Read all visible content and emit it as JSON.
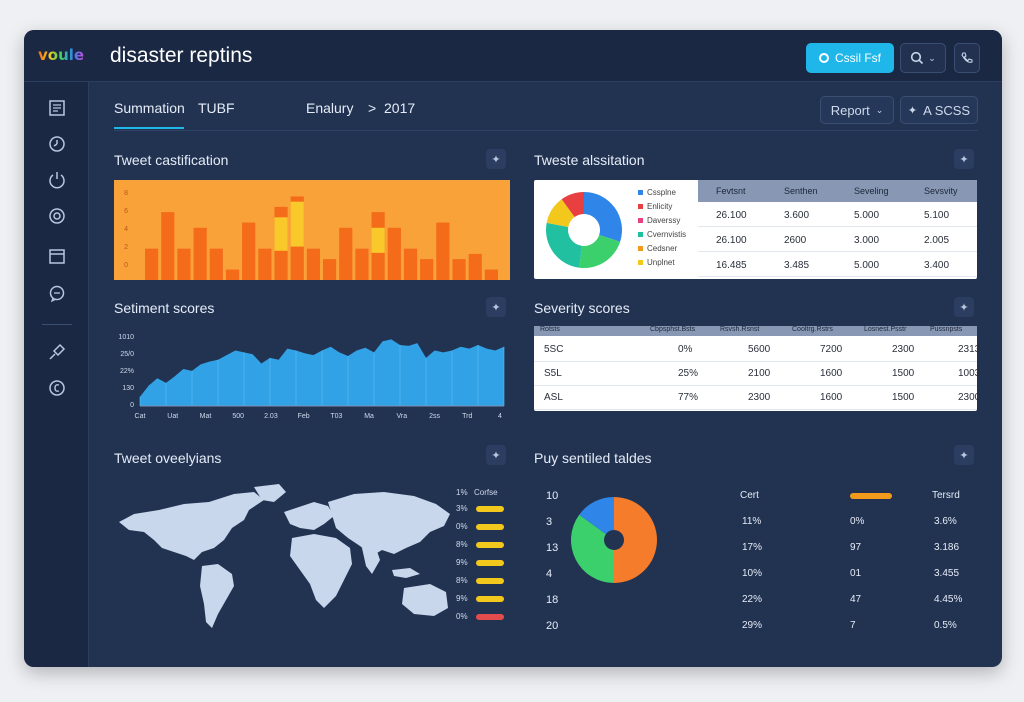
{
  "app": {
    "logo": "voule",
    "title": "disaster reptins"
  },
  "header": {
    "primary_button": "Cssil Fsf",
    "search_icon": "search-icon",
    "phone_icon": "phone-icon"
  },
  "tabs": {
    "active": "Summation",
    "tag": "TUBF",
    "crumb_left": "Enalury",
    "crumb_sep": ">",
    "crumb_right": "2017"
  },
  "toolbar": {
    "report": "Report",
    "access": "A SCSS"
  },
  "panels": {
    "tweet_class": {
      "title": "Tweet castification"
    },
    "tweet_assoc": {
      "title": "Tweste alssitation",
      "legend": [
        {
          "label": "Cssplne",
          "color": "#2f86e8"
        },
        {
          "label": "Enlicity",
          "color": "#e84040"
        },
        {
          "label": "Daverssy",
          "color": "#e84080"
        },
        {
          "label": "Cvernvistis",
          "color": "#21c0a0"
        },
        {
          "label": "Cedsner",
          "color": "#f29a1c"
        },
        {
          "label": "Unplnet",
          "color": "#f2c81c"
        }
      ],
      "headers": [
        "Fevtsnt",
        "Senthen",
        "Seveling",
        "Sevsvity"
      ],
      "rows": [
        [
          "26.100",
          "3.600",
          "5.000",
          "5.100"
        ],
        [
          "26.100",
          "2600",
          "3.000",
          "2.005"
        ],
        [
          "16.485",
          "3.485",
          "5.000",
          "3.400"
        ]
      ]
    },
    "sentiment": {
      "title": "Setiment scores",
      "yticks": [
        "1010",
        "25/0",
        "22%",
        "130",
        "0"
      ],
      "xticks": [
        "Cat",
        "Uat",
        "Mat",
        "500",
        "2.03",
        "Feb",
        "T03",
        "Ma",
        "Vra",
        "2ss",
        "Trd",
        "4"
      ]
    },
    "severity": {
      "title": "Severity scores",
      "headers": [
        "Rotsts",
        "Cbpsphst.Bsts",
        "Rsvsh.Rsnst",
        "Cooltrg.Rstrs",
        "Losnest.Psstr",
        "Pussnpsts"
      ],
      "rows": [
        [
          "5SC",
          "0%",
          "5600",
          "7200",
          "2300",
          "2313"
        ],
        [
          "S5L",
          "25%",
          "2100",
          "1600",
          "1500",
          "1003"
        ],
        [
          "ASL",
          "77%",
          "2300",
          "1600",
          "1500",
          "2300"
        ]
      ]
    },
    "tweet_overlay": {
      "title": "Tweet oveelyians",
      "legend_header": [
        "1%",
        "Corfse"
      ],
      "legend": [
        {
          "label": "3%",
          "color": "#f2c81c"
        },
        {
          "label": "0%",
          "color": "#f2c81c"
        },
        {
          "label": "8%",
          "color": "#f2c81c"
        },
        {
          "label": "9%",
          "color": "#f2c81c"
        },
        {
          "label": "8%",
          "color": "#f2c81c"
        },
        {
          "label": "9%",
          "color": "#f2c81c"
        },
        {
          "label": "0%",
          "color": "#e34c4c"
        }
      ]
    },
    "pie_table": {
      "title": "Puy sentiled taldes",
      "col_left": [
        "10",
        "3",
        "13",
        "4",
        "18",
        "20"
      ],
      "col_a_header": "Cert",
      "col_a": [
        "",
        "11%",
        "17%",
        "10%",
        "22%",
        "29%"
      ],
      "col_b": [
        "",
        "0%",
        "97",
        "01",
        "47",
        "7"
      ],
      "col_c_header": "Tersrd",
      "col_c": [
        "",
        "3.6%",
        "3.186",
        "3.455",
        "4.45%",
        "0.5%"
      ]
    }
  },
  "chart_data": [
    {
      "type": "bar",
      "title": "Tweet castification",
      "yticks": [
        "8",
        "6",
        "4",
        "2",
        "0"
      ],
      "values": [
        3,
        6.5,
        3,
        5,
        3,
        1,
        5.5,
        3,
        7,
        8,
        3,
        2,
        5,
        3,
        6.5,
        5,
        3,
        2,
        5.5,
        2,
        2.5,
        1
      ],
      "highlights": [
        0,
        0,
        0,
        0,
        0,
        0,
        0,
        0,
        6,
        7.5,
        0,
        0,
        0,
        0,
        5,
        0,
        0,
        0,
        0,
        0,
        0,
        0
      ],
      "ylim": [
        0,
        9
      ],
      "colors": {
        "bar": "#f46b1a",
        "highlight": "#f9c92b",
        "bg": "#f9a23a"
      }
    },
    {
      "type": "pie",
      "title": "Tweste alssitation",
      "values": [
        30,
        22,
        26,
        12,
        10
      ],
      "colors": [
        "#2f86e8",
        "#3bd06b",
        "#21c0a0",
        "#f2c81c",
        "#e84040"
      ]
    },
    {
      "type": "area",
      "title": "Setiment scores",
      "values": [
        10,
        22,
        30,
        25,
        32,
        40,
        38,
        45,
        48,
        50,
        55,
        60,
        58,
        56,
        46,
        52,
        50,
        62,
        60,
        57,
        55,
        60,
        64,
        58,
        54,
        60,
        63,
        58,
        70,
        72,
        66,
        65,
        68,
        52,
        60,
        58,
        60,
        64,
        62,
        66,
        62,
        60,
        64
      ],
      "ylim": [
        0,
        80
      ],
      "color": "#32a2e6"
    },
    {
      "type": "pie",
      "title": "Puy sentiled taldes",
      "values": [
        50,
        35,
        15
      ],
      "colors": [
        "#f47c2a",
        "#3bd06b",
        "#2f86e8"
      ]
    }
  ]
}
